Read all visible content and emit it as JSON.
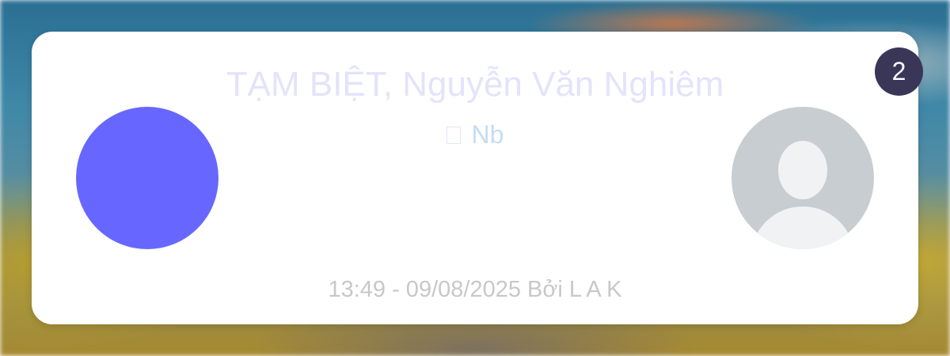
{
  "card": {
    "title": "TẠM BIỆT, Nguyễn Văn Nghiêm",
    "tag": {
      "icon": "missing-glyph-icon",
      "label": "Nb"
    },
    "footer": "13:49 - 09/08/2025 Bởi L A K",
    "left_avatar": {
      "color": "#6767ff"
    },
    "right_avatar": {
      "icon": "default-user-avatar-icon"
    }
  },
  "badge": {
    "count": "2"
  },
  "colors": {
    "title": "#e3e3fb",
    "tag": "#c6dcf2",
    "footer": "#c8c8c8",
    "badge_bg": "#393658"
  }
}
